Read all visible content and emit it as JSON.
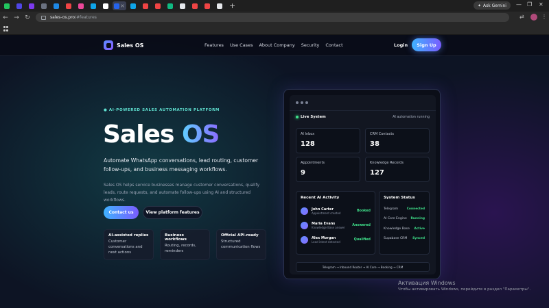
{
  "browser": {
    "tab_colors": [
      "#22c55e",
      "#4f46e5",
      "#7c3aed",
      "#6b7280",
      "#1e88e5",
      "#ef4444",
      "#ec4899",
      "#0ea5e9",
      "#ffffff",
      "#2563eb",
      "#0ea5e9",
      "#ef4444",
      "#ef4444",
      "#10b981",
      "#e5e7eb",
      "#ef4444",
      "#ef4444",
      "#e5e7eb"
    ],
    "ask_gemini": "Ask Gemini",
    "url_host": "sales-os.pro",
    "url_path": "/#features"
  },
  "nav": {
    "brand": "Sales OS",
    "items": [
      "Features",
      "Use Cases",
      "About Company",
      "Security",
      "Contact"
    ],
    "login": "Login",
    "signup": "Sign Up"
  },
  "hero": {
    "eyebrow": "AI-POWERED SALES AUTOMATION PLATFORM",
    "title_part1": "Sales",
    "title_part2": "OS",
    "lead": "Automate WhatsApp conversations, lead routing, customer follow-ups, and business messaging workflows.",
    "sub": "Sales OS helps service businesses manage customer conversations, qualify leads, route requests, and automate follow-ups using AI and structured workflows.",
    "cta_primary": "Contact us",
    "cta_secondary": "View platform features",
    "features": [
      {
        "title": "AI-assisted replies",
        "desc": "Customer conversations and next actions"
      },
      {
        "title": "Business workflows",
        "desc": "Routing, records, reminders"
      },
      {
        "title": "Official API-ready",
        "desc": "Structured communication flows"
      }
    ]
  },
  "dashboard": {
    "live_label": "Live System",
    "auto_label": "AI automation running",
    "stats": [
      {
        "label": "AI Inbox",
        "value": "128"
      },
      {
        "label": "CRM Contacts",
        "value": "38"
      },
      {
        "label": "Appointments",
        "value": "9"
      },
      {
        "label": "Knowledge Records",
        "value": "127"
      }
    ],
    "activity": {
      "title": "Recent AI Activity",
      "rows": [
        {
          "name": "John Carter",
          "sub": "Appointment created",
          "status": "Booked"
        },
        {
          "name": "Maria Evans",
          "sub": "Knowledge Base answer",
          "status": "Answered"
        },
        {
          "name": "Alex Morgan",
          "sub": "Lead intent detected",
          "status": "Qualified"
        }
      ]
    },
    "system": {
      "title": "System Status",
      "rows": [
        {
          "name": "Telegram",
          "value": "Connected"
        },
        {
          "name": "AI Core Engine",
          "value": "Running"
        },
        {
          "name": "Knowledge Base",
          "value": "Active"
        },
        {
          "name": "Supabase CRM",
          "value": "Synced"
        }
      ]
    },
    "flow": "Telegram → Inbound Router → AI Core → Booking → CRM"
  },
  "watermark": {
    "line1": "Активация Windows",
    "line2": "Чтобы активировать Windows, перейдите в раздел \"Параметры\"."
  }
}
